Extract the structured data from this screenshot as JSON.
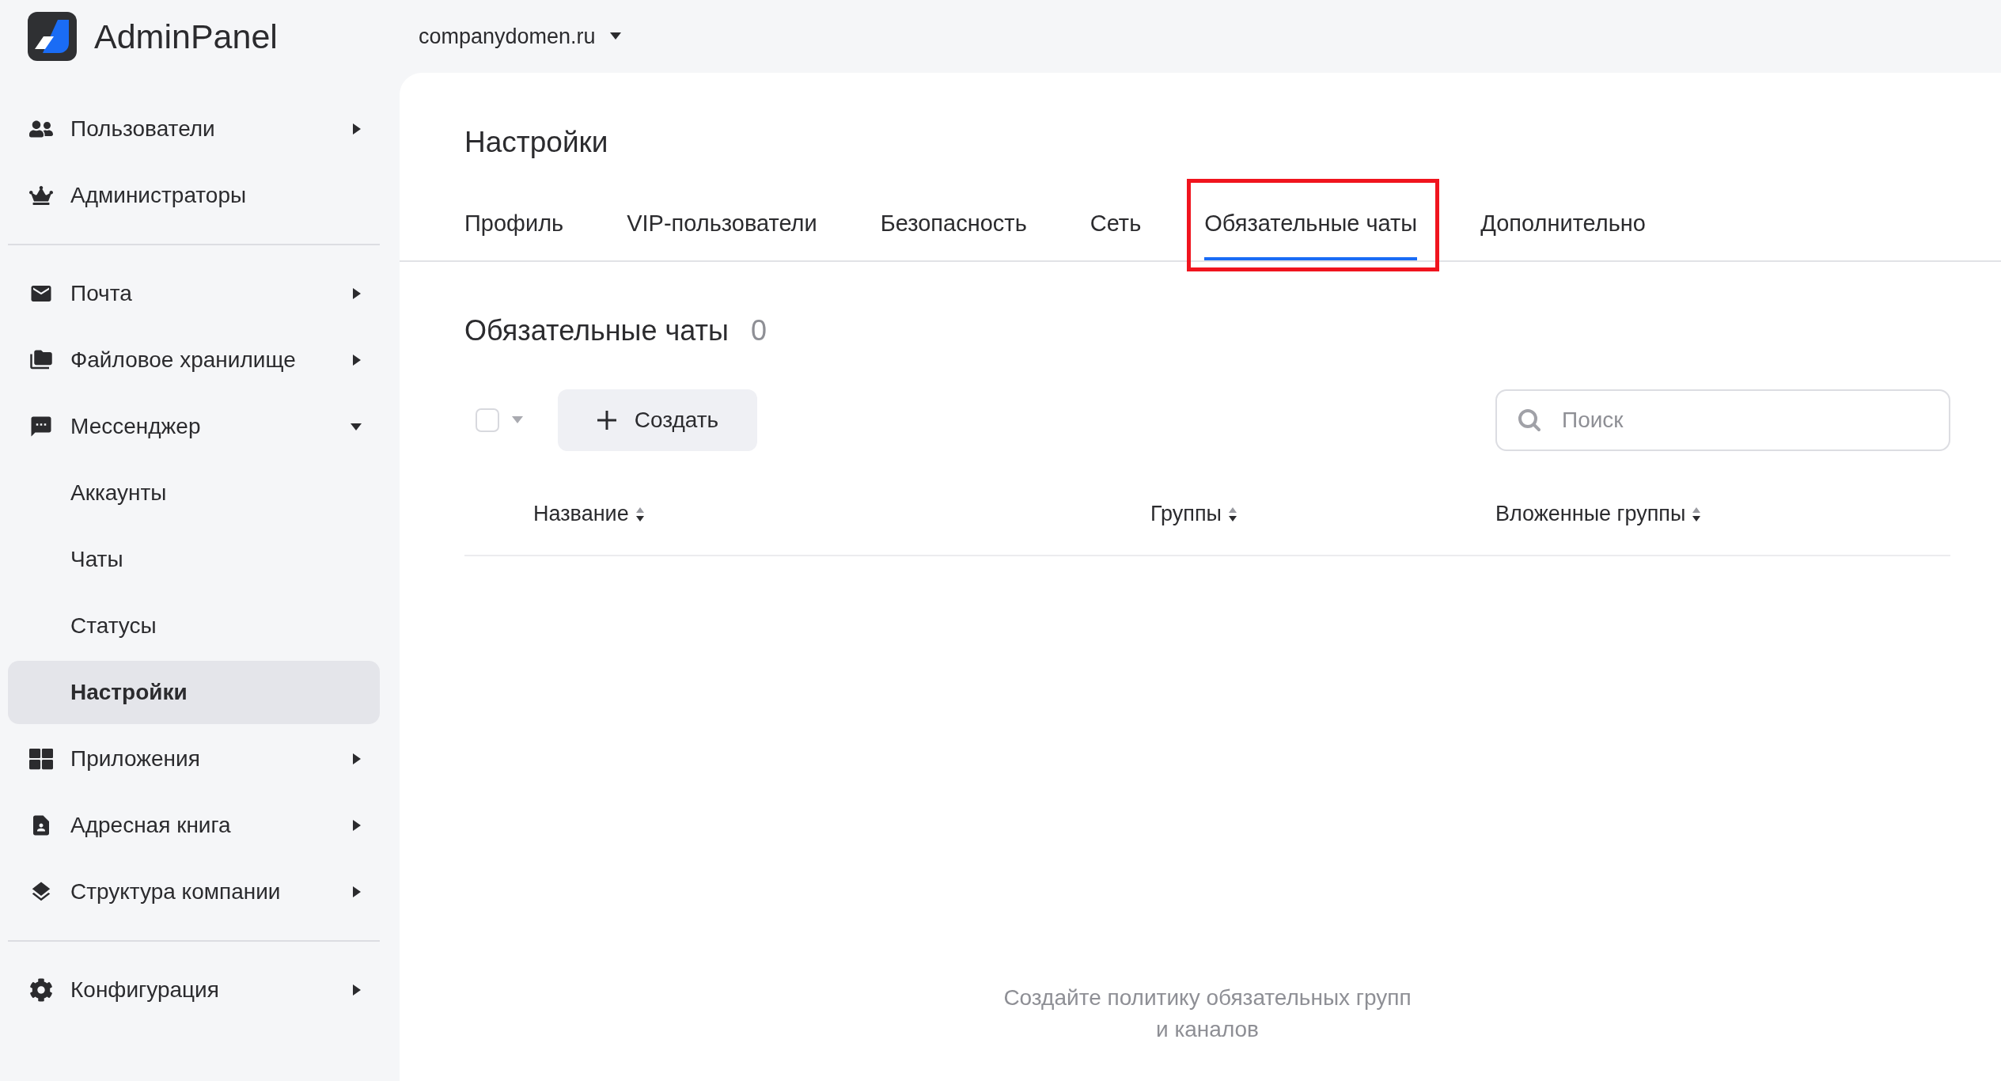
{
  "header": {
    "logo_text": "AdminPanel",
    "domain": "companydomen.ru"
  },
  "sidebar": {
    "groups": [
      [
        {
          "label": "Пользователи",
          "kind": "section",
          "expanded": false,
          "selected": false
        },
        {
          "label": "Администраторы",
          "kind": "link",
          "selected": false
        }
      ],
      [
        {
          "label": "Почта",
          "kind": "section",
          "expanded": false,
          "selected": false
        },
        {
          "label": "Файловое хранилище",
          "kind": "section",
          "expanded": false,
          "selected": false
        },
        {
          "label": "Мессенджер",
          "kind": "section",
          "expanded": true,
          "selected": false,
          "children": [
            {
              "label": "Аккаунты",
              "selected": false
            },
            {
              "label": "Чаты",
              "selected": false
            },
            {
              "label": "Статусы",
              "selected": false
            },
            {
              "label": "Настройки",
              "selected": true
            }
          ]
        },
        {
          "label": "Приложения",
          "kind": "section",
          "expanded": false,
          "selected": false
        },
        {
          "label": "Адресная книга",
          "kind": "section",
          "expanded": false,
          "selected": false
        },
        {
          "label": "Структура компании",
          "kind": "section",
          "expanded": false,
          "selected": false
        }
      ],
      [
        {
          "label": "Конфигурация",
          "kind": "section",
          "expanded": false,
          "selected": false
        }
      ]
    ]
  },
  "page": {
    "title": "Настройки",
    "tabs": [
      {
        "label": "Профиль",
        "selected": false,
        "annotated": false
      },
      {
        "label": "VIP-пользователи",
        "selected": false,
        "annotated": false
      },
      {
        "label": "Безопасность",
        "selected": false,
        "annotated": false
      },
      {
        "label": "Сеть",
        "selected": false,
        "annotated": false
      },
      {
        "label": "Обязательные чаты",
        "selected": true,
        "annotated": true
      },
      {
        "label": "Дополнительно",
        "selected": false,
        "annotated": false
      }
    ],
    "section": {
      "title": "Обязательные чаты",
      "count": "0"
    },
    "toolbar": {
      "select_all": {
        "checked": false
      },
      "create_button": "Создать",
      "search": {
        "placeholder": "Поиск"
      }
    },
    "table": {
      "columns": [
        {
          "label": "Название"
        },
        {
          "label": "Группы"
        },
        {
          "label": "Вложенные группы"
        }
      ]
    },
    "empty_message": "Создайте политику обязательных групп\nи каналов"
  }
}
